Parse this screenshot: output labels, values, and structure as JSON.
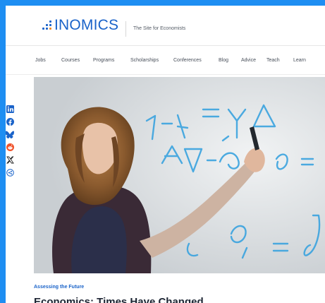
{
  "brand": {
    "name": "INOMICS",
    "tagline": "The Site for Economists",
    "colors": {
      "primary": "#1a63c9",
      "accent_orange": "#f08a24",
      "frame": "#1e8ef2"
    }
  },
  "nav": {
    "items": [
      {
        "label": "Jobs"
      },
      {
        "label": "Courses"
      },
      {
        "label": "Programs"
      },
      {
        "label": "Scholarships"
      },
      {
        "label": "Conferences"
      },
      {
        "label": "Blog"
      },
      {
        "label": "Advice"
      },
      {
        "label": "Teach"
      },
      {
        "label": "Learn"
      }
    ]
  },
  "share": {
    "icons": [
      "linkedin-icon",
      "facebook-icon",
      "bluesky-icon",
      "reddit-icon",
      "x-icon",
      "share-icon"
    ]
  },
  "article": {
    "kicker": "Assessing the Future",
    "title": "Economics: Times Have Changed"
  }
}
